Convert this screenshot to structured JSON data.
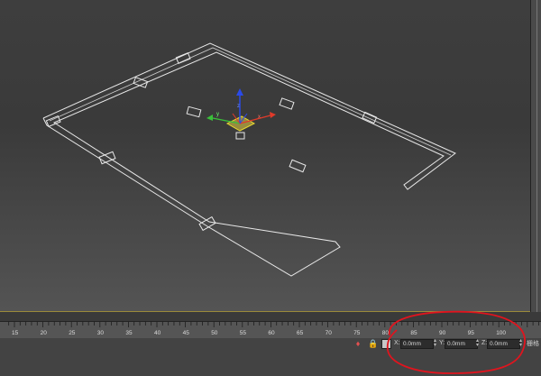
{
  "ruler": {
    "ticks": [
      "15",
      "20",
      "25",
      "30",
      "35",
      "40",
      "45",
      "50",
      "55",
      "60",
      "65",
      "70",
      "75",
      "80",
      "85",
      "90",
      "95",
      "100"
    ]
  },
  "status": {
    "x_label": "X:",
    "y_label": "Y:",
    "z_label": "Z:",
    "x_value": "0.0mm",
    "y_value": "0.0mm",
    "z_value": "0.0mm",
    "grid_label": "栅格"
  },
  "colors": {
    "annotation": "#e0141e",
    "gizmo_x": "#e03a2a",
    "gizmo_y": "#3ac03a",
    "gizmo_z": "#2a4ae8",
    "gizmo_plane": "#e8d830",
    "wireframe": "#ffffff"
  },
  "icons": [
    "key-icon",
    "lock-icon",
    "selection-mode-icon"
  ]
}
